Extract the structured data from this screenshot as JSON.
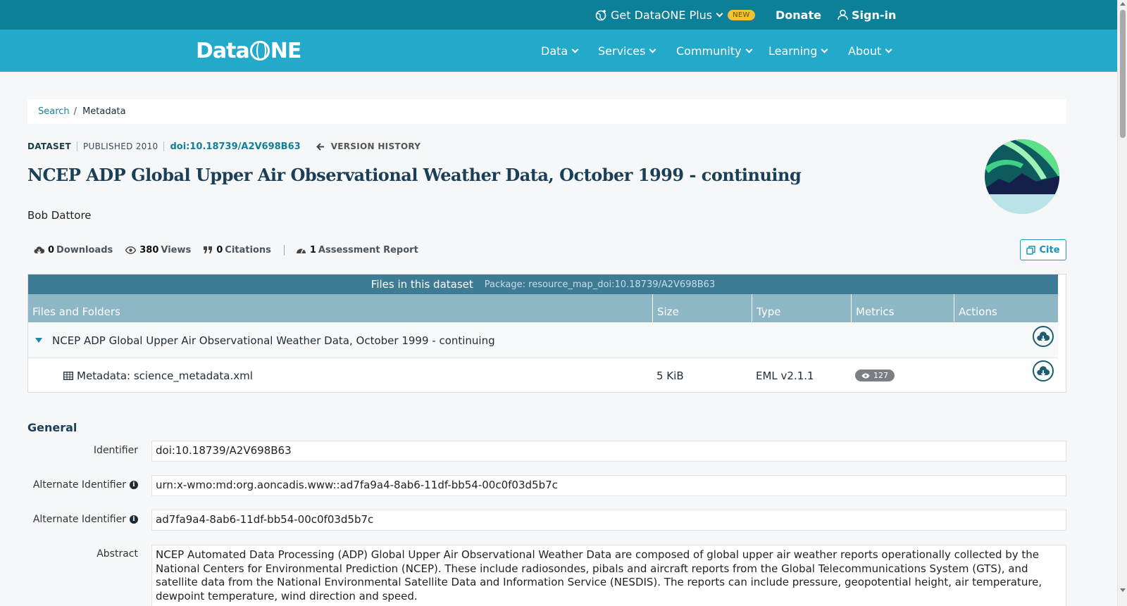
{
  "topbar": {
    "plus_label": "Get DataONE Plus",
    "new_badge": "NEW",
    "donate_label": "Donate",
    "signin_label": "Sign-in"
  },
  "nav": {
    "logo_left": "Data",
    "logo_right": "NE",
    "items": [
      "Data",
      "Services",
      "Community",
      "Learning",
      "About"
    ]
  },
  "breadcrumb": {
    "search": "Search",
    "separator": "/",
    "current": "Metadata"
  },
  "meta": {
    "type": "DATASET",
    "published": "PUBLISHED 2010",
    "doi": "doi:10.18739/A2V698B63",
    "version_history": "VERSION HISTORY"
  },
  "dataset": {
    "title": "NCEP ADP Global Upper Air Observational Weather Data, October 1999 - continuing",
    "author": "Bob Dattore"
  },
  "stats": {
    "downloads_count": "0",
    "downloads_label": "Downloads",
    "views_count": "380",
    "views_label": "Views",
    "citations_count": "0",
    "citations_label": "Citations",
    "assessment_count": "1",
    "assessment_label": "Assessment Report",
    "cite_label": "Cite"
  },
  "files": {
    "heading": "Files in this dataset",
    "package": "Package: resource_map_doi:10.18739/A2V698B63",
    "columns": [
      "Files and Folders",
      "Size",
      "Type",
      "Metrics",
      "Actions"
    ],
    "folder_name": "NCEP ADP Global Upper Air Observational Weather Data, October 1999 - continuing",
    "file": {
      "name": "Metadata: science_metadata.xml",
      "size": "5 KiB",
      "type": "EML v2.1.1",
      "views": "127"
    }
  },
  "general": {
    "heading": "General",
    "identifier_label": "Identifier",
    "identifier_value": "doi:10.18739/A2V698B63",
    "alt_label_1": "Alternate Identifier",
    "alt_value_1": "urn:x-wmo:md:org.aoncadis.www::ad7fa9a4-8ab6-11df-bb54-00c0f03d5b7c",
    "alt_label_2": "Alternate Identifier",
    "alt_value_2": "ad7fa9a4-8ab6-11df-bb54-00c0f03d5b7c",
    "abstract_label": "Abstract",
    "abstract_text": "NCEP Automated Data Processing (ADP) Global Upper Air Observational Weather Data are composed of global upper air weather reports operationally collected by the National Centers for Environmental Prediction (NCEP). These include radiosondes, pibals and aircraft reports from the Global Telecommunications System (GTS), and satellite data from the National Environmental Satellite Data and Information Service (NESDIS). The reports can include pressure, geopotential height, air temperature, dewpoint temperature, wind direction and speed."
  },
  "colors": {
    "topbar": "#0c7f99",
    "navbar": "#23a9c9",
    "table_header": "#3e7b95",
    "column_header": "#8eb7c6",
    "link": "#1a7fa0"
  }
}
